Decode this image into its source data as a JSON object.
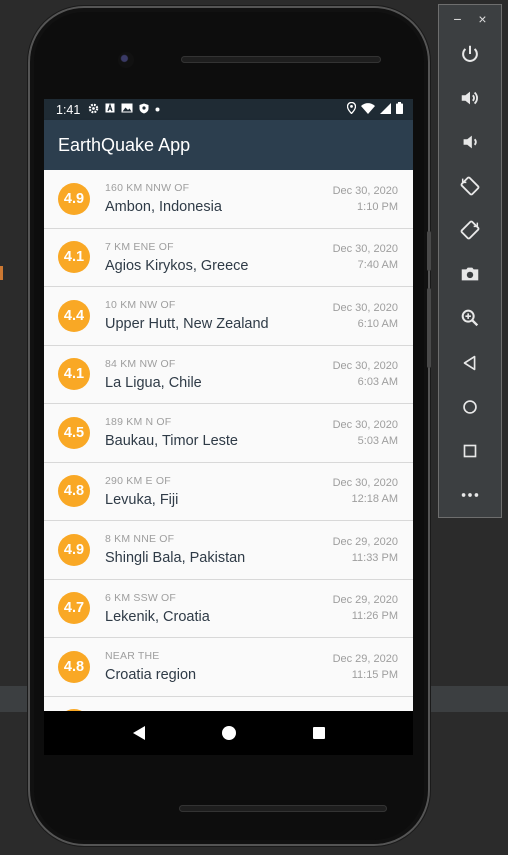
{
  "app": {
    "title": "EarthQuake App"
  },
  "status_bar": {
    "time": "1:41",
    "left_icons": [
      "gear-icon",
      "a-icon",
      "image-icon",
      "shield-icon",
      "dot-icon"
    ],
    "right_icons": [
      "location-icon",
      "wifi-icon",
      "signal-icon",
      "battery-icon"
    ]
  },
  "earthquakes": [
    {
      "magnitude": "4.9",
      "offset": "160 km NNW of",
      "primary": "Ambon, Indonesia",
      "date": "Dec 30, 2020",
      "time": "1:10 PM"
    },
    {
      "magnitude": "4.1",
      "offset": "7 km ENE of",
      "primary": "Agios Kirykos, Greece",
      "date": "Dec 30, 2020",
      "time": "7:40 AM"
    },
    {
      "magnitude": "4.4",
      "offset": "10 km NW of",
      "primary": "Upper Hutt, New Zealand",
      "date": "Dec 30, 2020",
      "time": "6:10 AM"
    },
    {
      "magnitude": "4.1",
      "offset": "84 km NW of",
      "primary": "La Ligua, Chile",
      "date": "Dec 30, 2020",
      "time": "6:03 AM"
    },
    {
      "magnitude": "4.5",
      "offset": "189 km N of",
      "primary": "Baukau, Timor Leste",
      "date": "Dec 30, 2020",
      "time": "5:03 AM"
    },
    {
      "magnitude": "4.8",
      "offset": "290 km E of",
      "primary": "Levuka, Fiji",
      "date": "Dec 30, 2020",
      "time": "12:18 AM"
    },
    {
      "magnitude": "4.9",
      "offset": "8 km NNE of",
      "primary": "Shingli Bala, Pakistan",
      "date": "Dec 29, 2020",
      "time": "11:33 PM"
    },
    {
      "magnitude": "4.7",
      "offset": "6 km SSW of",
      "primary": "Lekenik, Croatia",
      "date": "Dec 29, 2020",
      "time": "11:26 PM"
    },
    {
      "magnitude": "4.8",
      "offset": "Near the",
      "primary": "Croatia region",
      "date": "Dec 29, 2020",
      "time": "11:15 PM"
    }
  ],
  "colors": {
    "magnitude_circle": "#f9a825",
    "app_bar": "#2c3e4e",
    "status_bar": "#1f2b34"
  },
  "nav_bar": [
    "back-icon",
    "home-icon",
    "recents-icon"
  ],
  "emulator_toolbar": {
    "window_controls": [
      "−",
      "×"
    ],
    "buttons": [
      "power-icon",
      "volume-up-icon",
      "volume-down-icon",
      "rotate-left-icon",
      "rotate-right-icon",
      "camera-icon",
      "zoom-icon",
      "back-icon",
      "home-icon",
      "overview-icon",
      "more-icon"
    ]
  }
}
